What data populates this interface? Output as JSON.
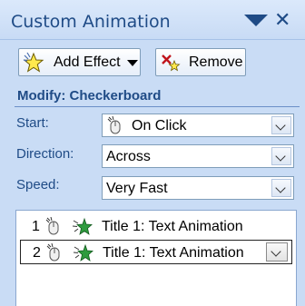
{
  "pane": {
    "title": "Custom Animation"
  },
  "toolbar": {
    "add_effect_label": "Add Effect",
    "remove_label": "Remove"
  },
  "modify": {
    "heading": "Modify: Checkerboard"
  },
  "properties": {
    "start_label": "Start:",
    "start_value": "On Click",
    "direction_label": "Direction:",
    "direction_value": "Across",
    "speed_label": "Speed:",
    "speed_value": "Very Fast"
  },
  "animation_list": [
    {
      "number": "1",
      "text": "Title 1: Text Animation",
      "selected": false
    },
    {
      "number": "2",
      "text": "Title 1: Text Animation",
      "selected": true
    }
  ],
  "icons": {
    "mouse": "mouse-click-icon",
    "effect": "entrance-effect-icon",
    "add": "star-icon",
    "remove": "remove-effect-icon"
  },
  "colors": {
    "pane_background": "#c9dcf5",
    "title_text": "#1f4b86"
  }
}
